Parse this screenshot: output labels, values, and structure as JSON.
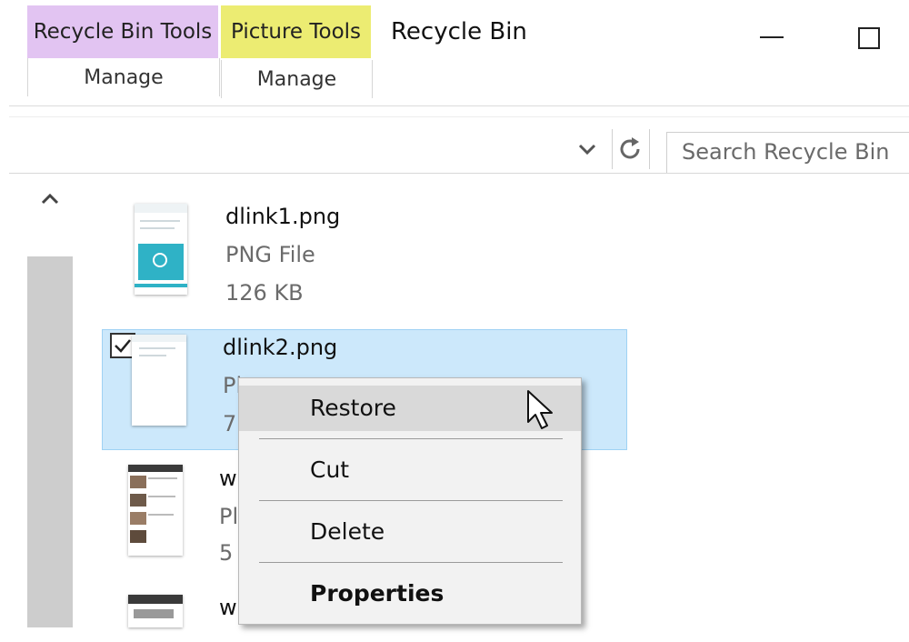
{
  "ribbon": {
    "context_tabs": [
      {
        "label": "Recycle Bin Tools",
        "color": "#e2c4f2",
        "subtab": "Manage"
      },
      {
        "label": "Picture Tools",
        "color": "#ecec72",
        "subtab": "Manage"
      }
    ],
    "window_title": "Recycle Bin"
  },
  "address_bar": {
    "search_placeholder": "Search Recycle Bin"
  },
  "files": [
    {
      "name": "dlink1.png",
      "type": "PNG File",
      "size": "126 KB",
      "selected": false
    },
    {
      "name": "dlink2.png",
      "type": "Pl",
      "size": "7",
      "selected": true
    },
    {
      "name": "w",
      "type": "Pl",
      "size": "5",
      "selected": false
    },
    {
      "name": "w",
      "type": "",
      "size": "",
      "selected": false
    }
  ],
  "context_menu": {
    "items": [
      {
        "label": "Restore",
        "highlighted": true,
        "bold": false
      },
      {
        "label": "Cut",
        "highlighted": false,
        "bold": false
      },
      {
        "label": "Delete",
        "highlighted": false,
        "bold": false
      },
      {
        "label": "Properties",
        "highlighted": false,
        "bold": true
      }
    ]
  },
  "colors": {
    "selection": "#cce8fb",
    "selection_border": "#9fd2f4",
    "menu_bg": "#f2f2f2",
    "menu_hot": "#d9d9d9"
  },
  "icons": [
    "chevron-down-icon",
    "refresh-icon",
    "scroll-up-icon",
    "minimize-icon",
    "maximize-icon",
    "checkbox-icon",
    "mouse-cursor-icon"
  ]
}
